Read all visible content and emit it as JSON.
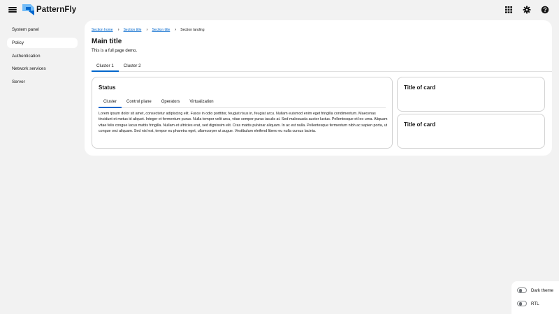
{
  "brand": {
    "name": "PatternFly"
  },
  "header": {
    "icons": [
      "hamburger-menu-icon",
      "grid-icon",
      "gear-icon",
      "help-icon"
    ]
  },
  "sidebar": {
    "items": [
      {
        "label": "System panel"
      },
      {
        "label": "Policy"
      },
      {
        "label": "Authentication"
      },
      {
        "label": "Network services"
      },
      {
        "label": "Server"
      }
    ],
    "active_index": 1
  },
  "breadcrumb": {
    "items": [
      "Section home",
      "Section title",
      "Section title"
    ],
    "current": "Section landing"
  },
  "page": {
    "title": "Main title",
    "description": "This is a full page demo.",
    "tabs": [
      "Cluster 1",
      "Cluster 2"
    ]
  },
  "status_card": {
    "title": "Status",
    "tabs": [
      "Cluster",
      "Control plane",
      "Operators",
      "Virtualization"
    ],
    "body": "Lorem ipsum dolor sit amet, consectetur adipiscing elit. Fusce in odio porttitor, feugiat risus in, feugiat arcu. Nullam euismod enim eget fringilla condimentum. Maecenas tincidunt et metus id aliquet. Integer et fermentum purus. Nulla tempor velit arcu, vitae semper purus iaculis at. Sed malesuada auctor luctus. Pellentesque et leo urna. Aliquam vitae felis congue lacus mattis fringilla. Nullam et ultricies erat, sed dignissim elit. Cras mattis pulvinar aliquam. In ac est nulla. Pellentesque fermentum nibh ac sapien porta, ut congue orci aliquam. Sed nisl est, tempor eu pharetra eget, ullamcorper ut augue. Vestibulum eleifend libero eu nulla cursus lacinia."
  },
  "side_cards": [
    {
      "title": "Title of card"
    },
    {
      "title": "Title of card"
    }
  ],
  "theme_toggles": {
    "dark_theme": "Dark theme",
    "rtl": "RTL"
  },
  "colors": {
    "link": "#0066cc",
    "tab_underline": "#0066cc",
    "logo_light": "#73bcf7",
    "logo_dark": "#0066cc"
  }
}
